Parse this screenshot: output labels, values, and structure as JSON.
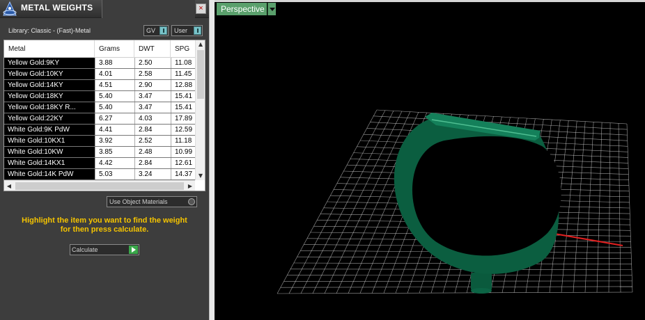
{
  "panel": {
    "title": "METAL WEIGHTS",
    "close_label": "×",
    "library_label": "Library: Classic - (Fast)-Metal",
    "toggle_gv": "GV",
    "toggle_user": "User",
    "use_object_materials": "Use Object Materials",
    "instructions_line1": "Highlight the item you want to find the weight",
    "instructions_line2": "for then press calculate.",
    "calculate_label": "Calculate"
  },
  "table": {
    "columns": [
      "Metal",
      "Grams",
      "DWT",
      "SPG"
    ],
    "rows": [
      [
        "Yellow Gold:9KY",
        "3.88",
        "2.50",
        "11.08"
      ],
      [
        "Yellow Gold:10KY",
        "4.01",
        "2.58",
        "11.45"
      ],
      [
        "Yellow Gold:14KY",
        "4.51",
        "2.90",
        "12.88"
      ],
      [
        "Yellow Gold:18KY",
        "5.40",
        "3.47",
        "15.41"
      ],
      [
        "Yellow Gold:18KY R...",
        "5.40",
        "3.47",
        "15.41"
      ],
      [
        "Yellow Gold:22KY",
        "6.27",
        "4.03",
        "17.89"
      ],
      [
        "White Gold:9K PdW",
        "4.41",
        "2.84",
        "12.59"
      ],
      [
        "White Gold:10KX1",
        "3.92",
        "2.52",
        "11.18"
      ],
      [
        "White Gold:10KW",
        "3.85",
        "2.48",
        "10.99"
      ],
      [
        "White Gold:14KX1",
        "4.42",
        "2.84",
        "12.61"
      ],
      [
        "White Gold:14K PdW",
        "5.03",
        "3.24",
        "14.37"
      ]
    ]
  },
  "viewport": {
    "view_label": "Perspective",
    "ring_color": "#0e6b4a",
    "grid_color": "#d0d0d0",
    "x_axis_color": "#e02020",
    "y_axis_color": "#2bb5c8"
  }
}
